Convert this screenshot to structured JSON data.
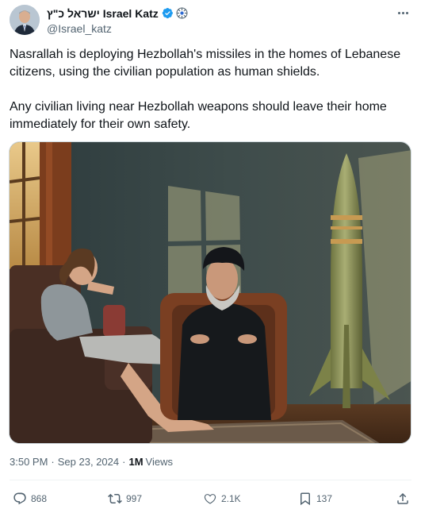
{
  "author": {
    "display_name": "ישראל כ\"ץ Israel Katz",
    "handle": "@Israel_katz",
    "verified_badge_color": "#1d9bf0"
  },
  "tweet": {
    "paragraphs": [
      "Nasrallah is deploying Hezbollah's missiles in the homes of Lebanese citizens, using the civilian population as human shields.",
      "Any civilian living near Hezbollah weapons should leave their home immediately for their own safety."
    ]
  },
  "meta": {
    "time": "3:50 PM",
    "separator1": "·",
    "date": "Sep 23, 2024",
    "separator2": "·",
    "views_count": "1M",
    "views_label": "Views"
  },
  "actions": {
    "replies": "868",
    "reposts": "997",
    "likes": "2.1K",
    "bookmarks": "137"
  },
  "icons": {
    "more": "more-options-icon",
    "verified": "verified-badge-icon",
    "government": "government-badge-icon",
    "reply": "reply-icon",
    "repost": "repost-icon",
    "like": "like-icon",
    "bookmark": "bookmark-icon",
    "share": "share-icon"
  },
  "colors": {
    "text_primary": "#0f1419",
    "text_secondary": "#536471",
    "border": "#cfd9de"
  }
}
